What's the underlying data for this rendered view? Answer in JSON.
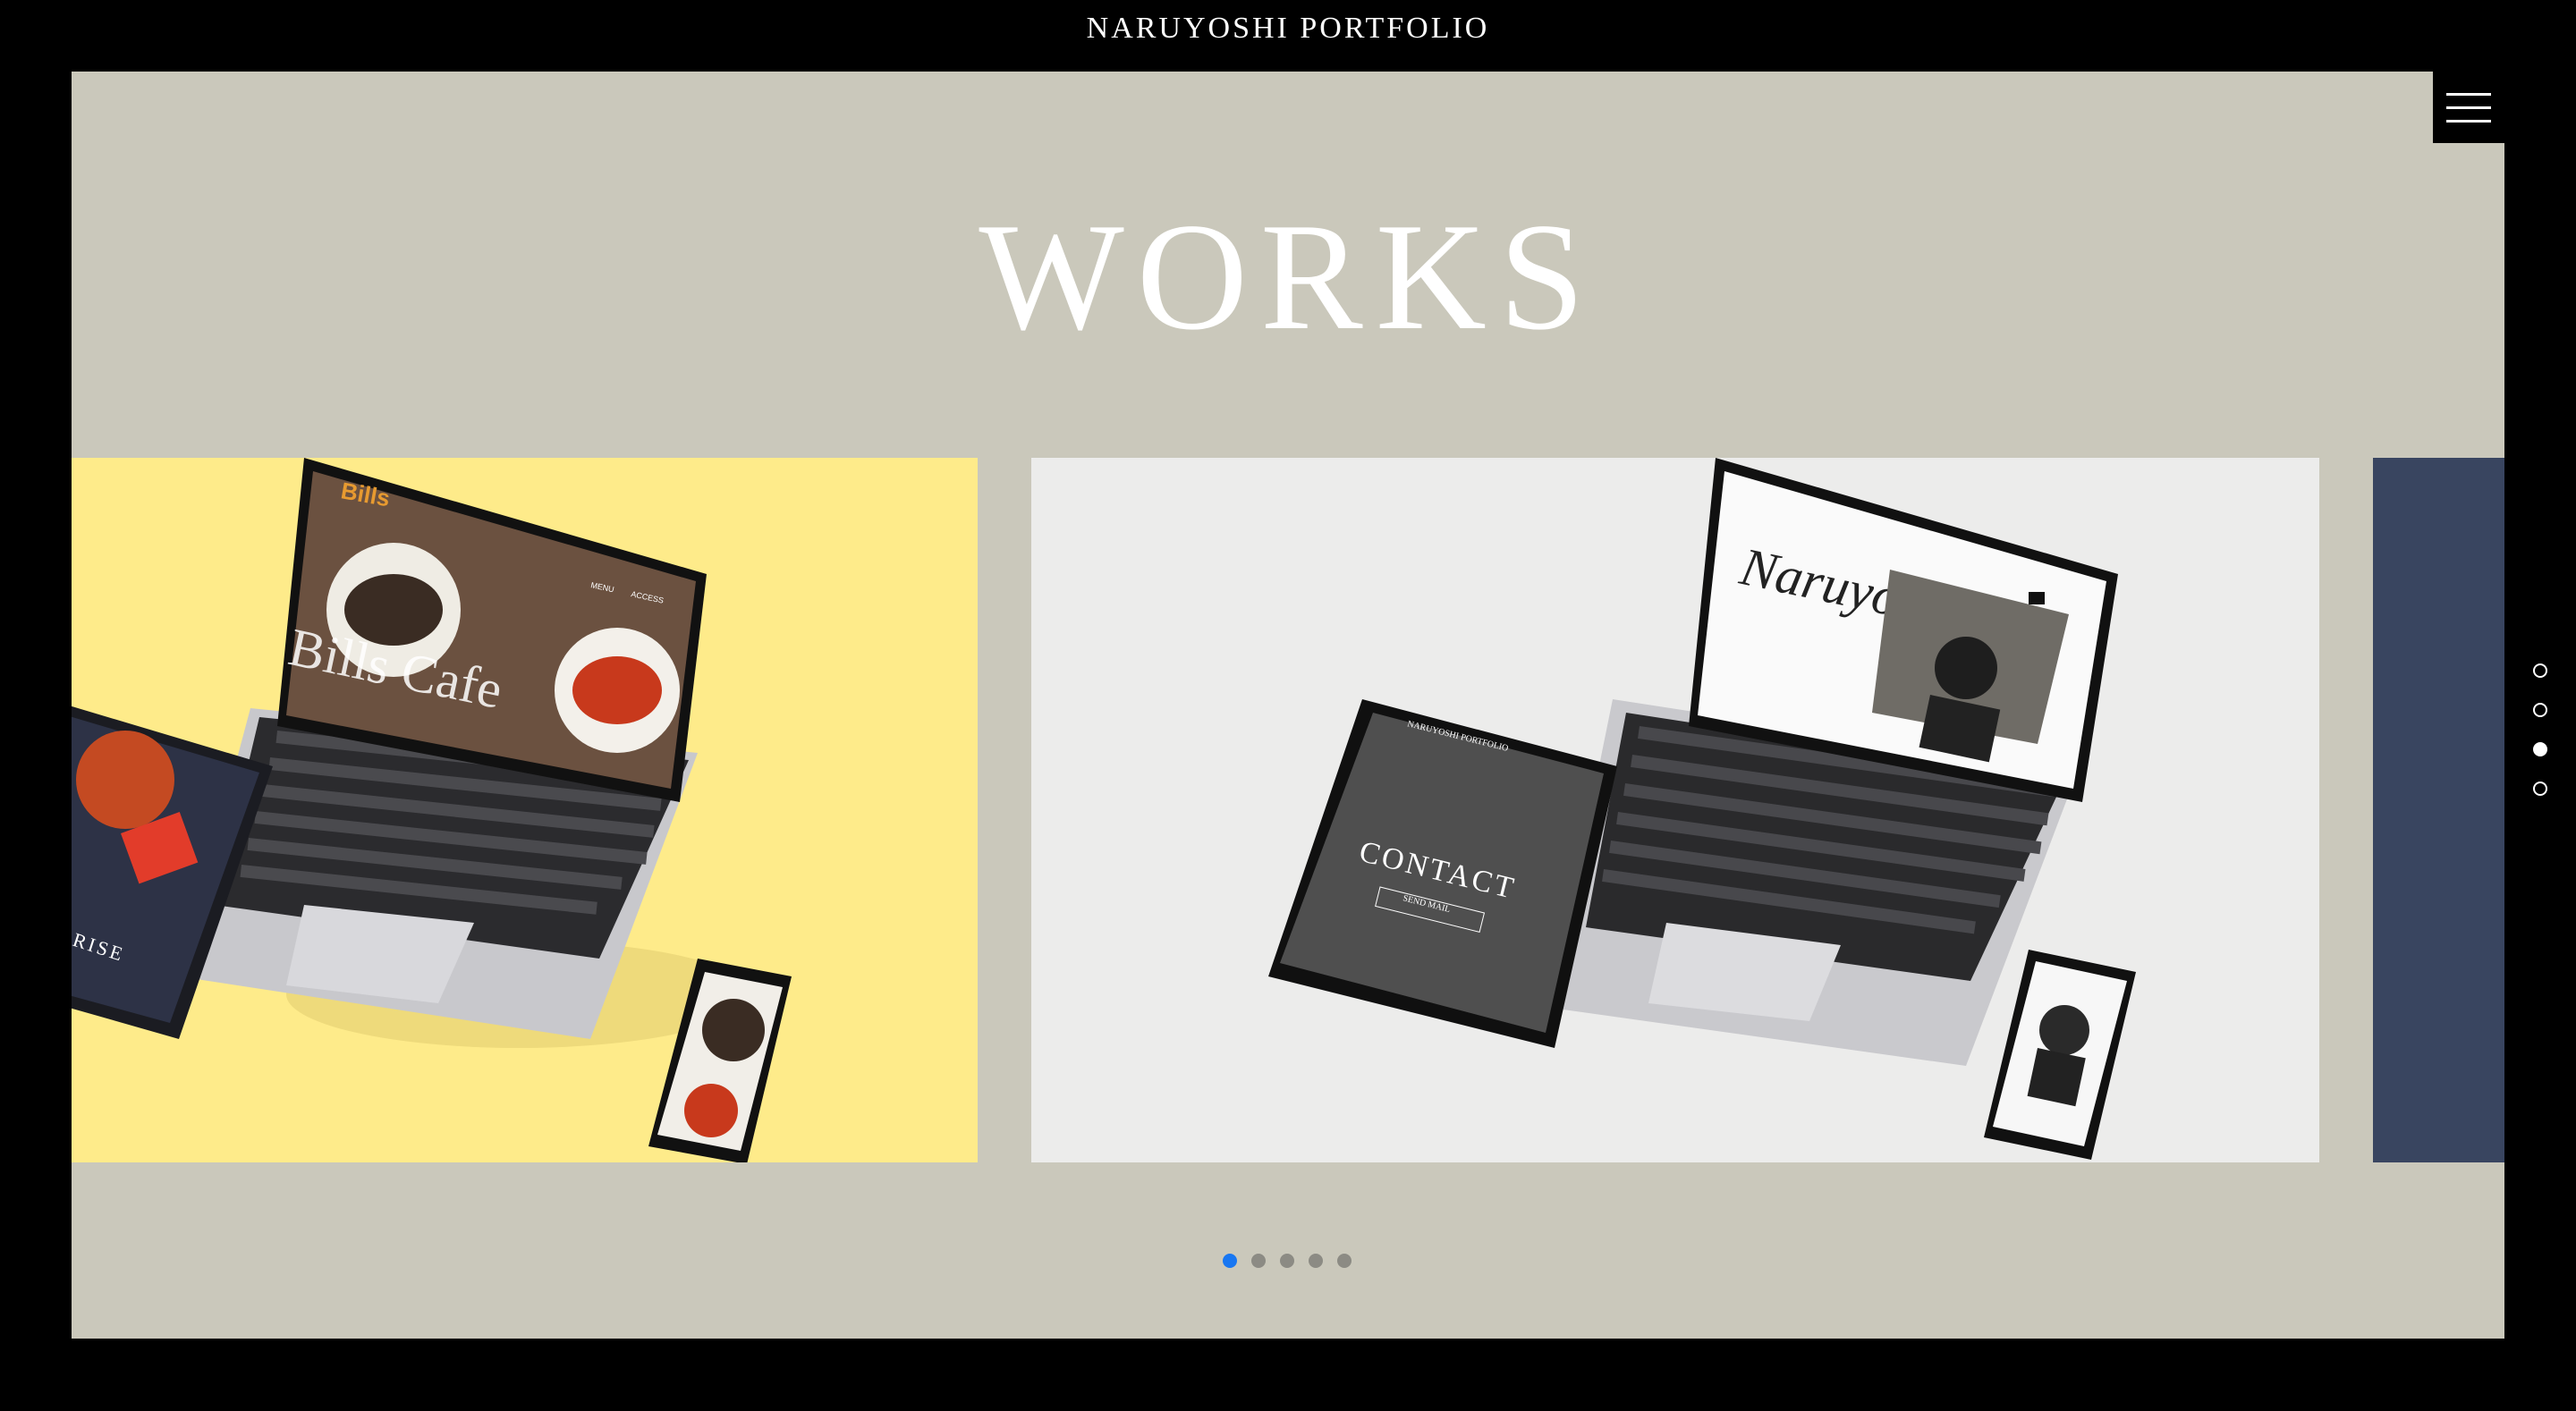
{
  "header": {
    "site_title": "NARUYOSHI PORTFOLIO"
  },
  "menu": {
    "icon": "hamburger-icon"
  },
  "section": {
    "heading": "WORKS"
  },
  "slides": [
    {
      "background": "#feeb8a",
      "screen_texts": {
        "brand": "Bills",
        "hero_caption": "Bills Cafe",
        "menu_1": "MENU",
        "menu_2": "ACCESS",
        "tablet_caption": "RISE"
      }
    },
    {
      "background": "#ececeb",
      "screen_texts": {
        "signature": "Naruyoshi",
        "tablet_header": "NARUYOSHI PORTFOLIO",
        "tablet_caption": "CONTACT",
        "tablet_button": "SEND MAIL"
      }
    },
    {
      "background": "#394560"
    }
  ],
  "carousel": {
    "total": 5,
    "current": 1,
    "active_color": "#1877f2"
  },
  "side_nav": {
    "total": 4,
    "current": 3
  },
  "colors": {
    "page_bg": "#000000",
    "frame_bg": "#cac8bb"
  }
}
